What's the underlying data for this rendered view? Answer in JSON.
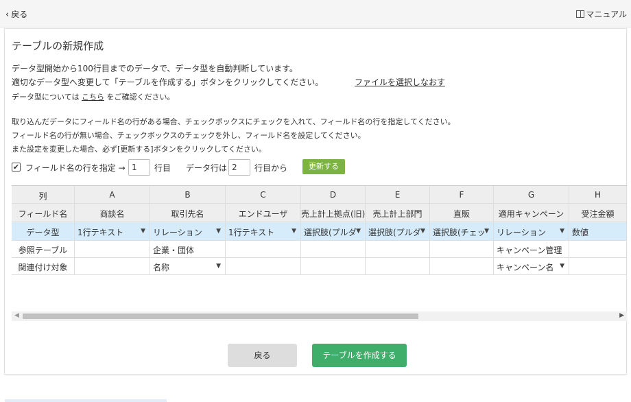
{
  "topbar": {
    "back_label": "戻る",
    "manual_label": "マニュアル"
  },
  "title": "テーブルの新規作成",
  "desc": {
    "line1": "データ型開始から100行目までのデータで、データ型を自動判断しています。",
    "line2": "適切なデータ型へ変更して「テーブルを作成する」ボタンをクリックしてください。",
    "reselect_link": "ファイルを選択しなおす",
    "line3_pre": "データ型については",
    "line3_link": "こちら",
    "line3_post": "をご確認ください。",
    "note1": "取り込んだデータにフィールド名の行がある場合、チェックボックスにチェックを入れて、フィールド名の行を指定してください。",
    "note2": "フィールド名の行が無い場合、チェックボックスのチェックを外し、フィールド名を設定してください。",
    "note3": "また設定を変更した場合、必ず[更新する]ボタンをクリックしてください。"
  },
  "options": {
    "checked": true,
    "field_row_label": "フィールド名の行を指定 →",
    "field_row_value": "1",
    "row_suffix": "行目",
    "data_row_label": "データ行は",
    "data_row_value": "2",
    "data_row_suffix": "行目から",
    "update_button": "更新する"
  },
  "grid": {
    "columns": [
      "列",
      "A",
      "B",
      "C",
      "D",
      "E",
      "F",
      "G",
      "H"
    ],
    "field_names": [
      "フィールド名",
      "商談名",
      "取引先名",
      "エンドユーザ",
      "売上計上拠点(旧)",
      "売上計上部門",
      "直販",
      "適用キャンペーン",
      "受注金額"
    ],
    "data_types": [
      "データ型",
      "1行テキスト",
      "リレーション",
      "1行テキスト",
      "選択肢(プルダ",
      "選択肢(プルダ",
      "選択肢(チェッ",
      "リレーション",
      "数値"
    ],
    "ref_table": [
      "参照テーブル",
      "",
      "企業・団体",
      "",
      "",
      "",
      "",
      "キャンペーン管理",
      ""
    ],
    "link_target": [
      "関連付け対象",
      "",
      "名称",
      "",
      "",
      "",
      "",
      "キャンペーン名",
      ""
    ]
  },
  "footer": {
    "back_button": "戻る",
    "create_button": "テーブルを作成する"
  },
  "colors": {
    "update_green": "#7cb342",
    "create_green": "#3fae6a",
    "datatype_row": "#d6ecfb"
  }
}
